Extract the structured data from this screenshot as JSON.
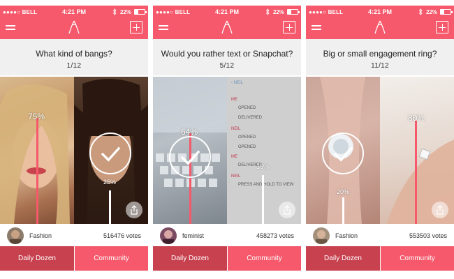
{
  "colors": {
    "accent": "#f5596b",
    "accent_dark": "#c7414f"
  },
  "status": {
    "carrier": "●●●●○ BELL",
    "time": "4:21 PM",
    "battery": "22%"
  },
  "tabs": {
    "daily": "Daily Dozen",
    "community": "Community"
  },
  "screens": [
    {
      "question": "What kind of bangs?",
      "page": "1/12",
      "left_pct": "75%",
      "left_value": 75,
      "right_pct": "25%",
      "right_value": 25,
      "category": "Fashion",
      "votes": "516476 votes"
    },
    {
      "question": "Would you rather text or Snapchat?",
      "page": "5/12",
      "left_pct": "64%",
      "left_value": 64,
      "right_pct": "36%",
      "right_value": 36,
      "category": "feminist",
      "votes": "458273 votes",
      "snap": {
        "back": "‹ NEIL",
        "me": "ME",
        "opened": "OPENED",
        "delivered": "DELIVERED",
        "neil": "NEIL",
        "press": "PRESS AND HOLD TO VIEW"
      }
    },
    {
      "question": "Big or small engagement ring?",
      "page": "11/12",
      "left_pct": "20%",
      "left_value": 20,
      "right_pct": "80%",
      "right_value": 80,
      "category": "Fashion",
      "votes": "553503 votes"
    }
  ],
  "icons": [
    "menu-icon",
    "logo-icon",
    "plus-icon",
    "check-icon",
    "share-icon",
    "bluetooth-icon",
    "wifi-icon",
    "battery-icon"
  ]
}
